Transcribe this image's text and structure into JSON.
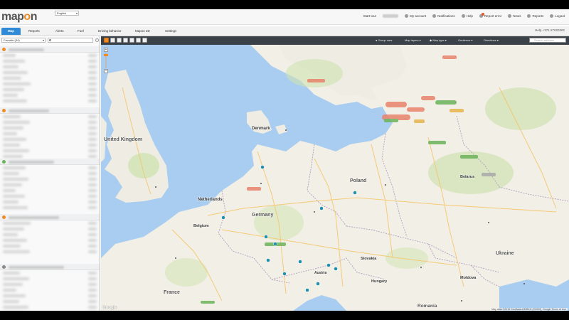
{
  "app": {
    "logo_left": "map",
    "logo_o": "o",
    "logo_right": "n",
    "language": "English"
  },
  "topnav": {
    "start_tour": "Start tour",
    "my_account": "My account",
    "notifications": "Notifications",
    "help": "Help",
    "report_error": "Report error",
    "news": "News",
    "reports": "Reports",
    "logout": "Logout"
  },
  "tabs": [
    {
      "label": "Map",
      "active": true
    },
    {
      "label": "Reports",
      "active": false
    },
    {
      "label": "Alerts",
      "active": false
    },
    {
      "label": "Fuel",
      "active": false
    },
    {
      "label": "Driving behavior",
      "active": false
    },
    {
      "label": "Mapon 2D",
      "active": false
    },
    {
      "label": "Settings",
      "active": false
    }
  ],
  "help_phone": "Help +371 67020392",
  "sidebar": {
    "favorites_label": "Favorite (34)",
    "search_placeholder": ""
  },
  "map_toolbar": {
    "group_cars": "Group cars",
    "map_layers": "Map layers",
    "map_type": "Map type",
    "geofence": "Geofence",
    "directions": "Directions",
    "search_placeholder": "Search address"
  },
  "map": {
    "labels": {
      "united_kingdom": "United Kingdom",
      "denmark": "Denmark",
      "netherlands": "Netherlands",
      "belgium": "Belgium",
      "germany": "Germany",
      "poland": "Poland",
      "france": "France",
      "ukraine": "Ukraine",
      "belarus": "Belarus",
      "slovakia": "Slovakia",
      "hungary": "Hungary",
      "romania": "Romania",
      "moldova": "Moldova",
      "austria": "Austria"
    },
    "google": "Google",
    "attribution": "Map data ©2015 GeoBasis-DE/BKG (©2009), Google  Terms of Use"
  },
  "colors": {
    "accent": "#2f8bd8",
    "brand_orange": "#f08a24",
    "toolbar_dark": "#3a4149",
    "sea": "#a8cdf0",
    "land": "#f2efe6",
    "green": "#cfe3b0"
  }
}
